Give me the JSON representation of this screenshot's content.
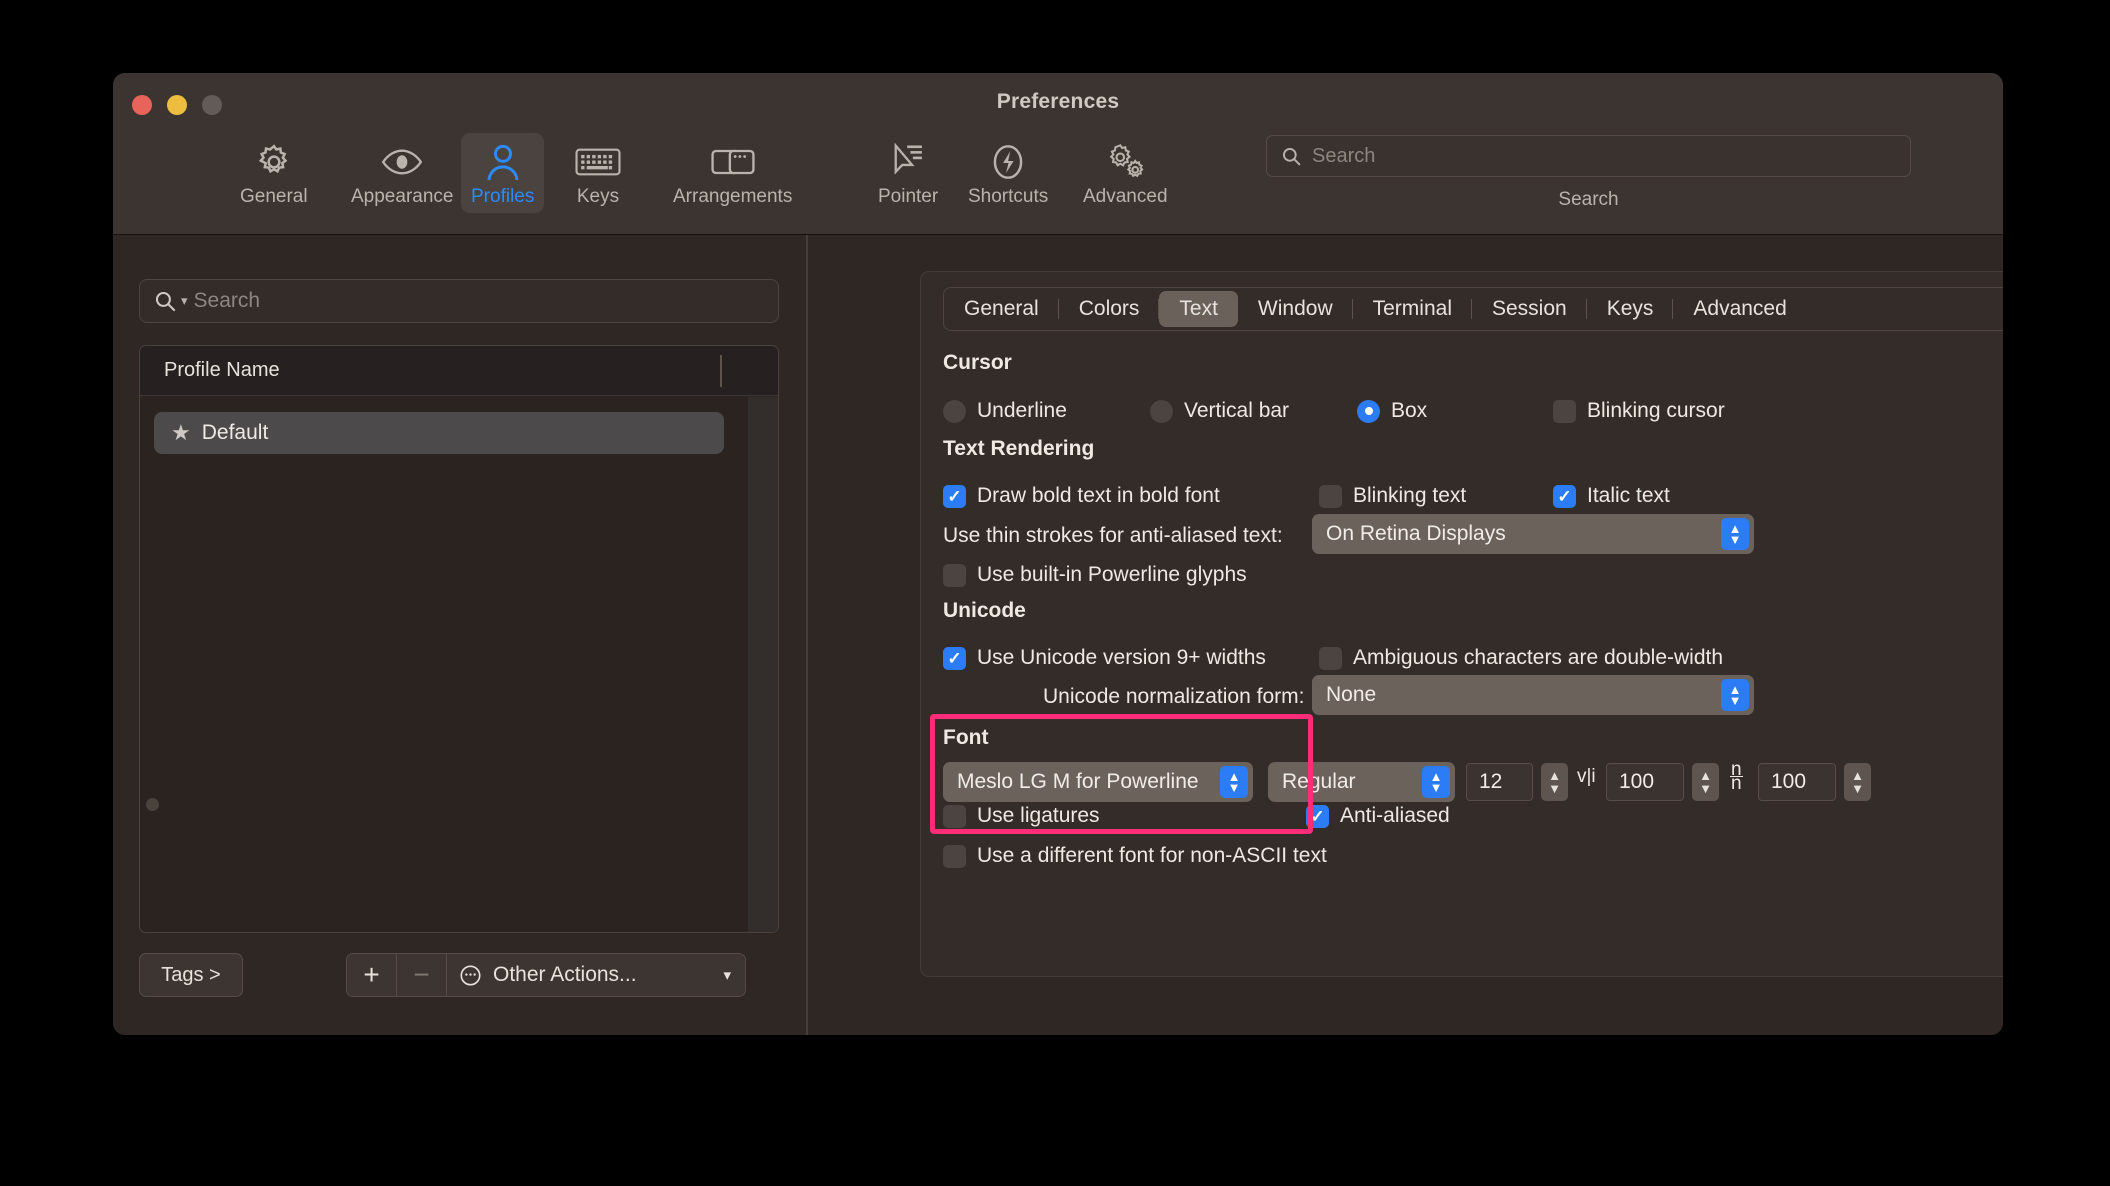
{
  "window": {
    "title": "Preferences"
  },
  "traffic_lights": [
    {
      "name": "close",
      "color": "#e8645a"
    },
    {
      "name": "minimize",
      "color": "#ecbd3f"
    },
    {
      "name": "zoom",
      "color": "#625b57"
    }
  ],
  "toolbar": {
    "items": [
      {
        "label": "General",
        "icon": "gear-icon",
        "active": false
      },
      {
        "label": "Appearance",
        "icon": "eye-icon",
        "active": false
      },
      {
        "label": "Profiles",
        "icon": "person-icon",
        "active": true
      },
      {
        "label": "Keys",
        "icon": "keyboard-icon",
        "active": false
      },
      {
        "label": "Arrangements",
        "icon": "windows-icon",
        "active": false
      },
      {
        "label": "Pointer",
        "icon": "cursor-icon",
        "active": false
      },
      {
        "label": "Shortcuts",
        "icon": "bolt-icon",
        "active": false
      },
      {
        "label": "Advanced",
        "icon": "gears-icon",
        "active": false
      }
    ],
    "search": {
      "placeholder": "Search",
      "value": "",
      "caption": "Search",
      "icon": "search-icon"
    },
    "accent_color": "#2b8bff"
  },
  "sidebar": {
    "search": {
      "placeholder": "Search",
      "value": "",
      "icon": "search-icon"
    },
    "table": {
      "column_header": "Profile Name",
      "rows": [
        {
          "name": "Default",
          "icon": "star-icon",
          "selected": true
        }
      ]
    },
    "footer": {
      "tags_label": "Tags >",
      "add_label": "+",
      "remove_label": "−",
      "other_actions_label": "Other Actions...",
      "other_actions_icon": "ellipsis-circle-icon",
      "chevron_icon": "chevron-down-icon"
    }
  },
  "tabs": [
    {
      "label": "General",
      "active": false
    },
    {
      "label": "Colors",
      "active": false
    },
    {
      "label": "Text",
      "active": true
    },
    {
      "label": "Window",
      "active": false
    },
    {
      "label": "Terminal",
      "active": false
    },
    {
      "label": "Session",
      "active": false
    },
    {
      "label": "Keys",
      "active": false
    },
    {
      "label": "Advanced",
      "active": false
    }
  ],
  "cursor": {
    "heading": "Cursor",
    "options": [
      {
        "label": "Underline",
        "selected": false
      },
      {
        "label": "Vertical bar",
        "selected": false
      },
      {
        "label": "Box",
        "selected": true
      }
    ],
    "blinking_cursor": {
      "label": "Blinking cursor",
      "checked": false
    }
  },
  "text_rendering": {
    "heading": "Text Rendering",
    "draw_bold": {
      "label": "Draw bold text in bold font",
      "checked": true
    },
    "blinking_text": {
      "label": "Blinking text",
      "checked": false
    },
    "italic_text": {
      "label": "Italic text",
      "checked": true
    },
    "thin_strokes": {
      "label": "Use thin strokes for anti-aliased text:",
      "value": "On Retina Displays"
    },
    "powerline": {
      "label": "Use built-in Powerline glyphs",
      "checked": false
    }
  },
  "unicode": {
    "heading": "Unicode",
    "version9": {
      "label": "Use Unicode version 9+ widths",
      "checked": true
    },
    "ambiguous": {
      "label": "Ambiguous characters are double-width",
      "checked": false
    },
    "normalization": {
      "label": "Unicode normalization form:",
      "value": "None"
    }
  },
  "font": {
    "heading": "Font",
    "family": "Meslo LG M for Powerline",
    "style": "Regular",
    "size": "12",
    "horizontal_spacing": {
      "glyph": "v|i",
      "value": "100"
    },
    "vertical_spacing": {
      "glyph": "n/n",
      "value": "100"
    },
    "ligatures": {
      "label": "Use ligatures",
      "checked": false
    },
    "anti_aliased": {
      "label": "Anti-aliased",
      "checked": true
    },
    "non_ascii": {
      "label": "Use a different font for non-ASCII text",
      "checked": false
    },
    "highlight_color": "#ff2d78"
  }
}
